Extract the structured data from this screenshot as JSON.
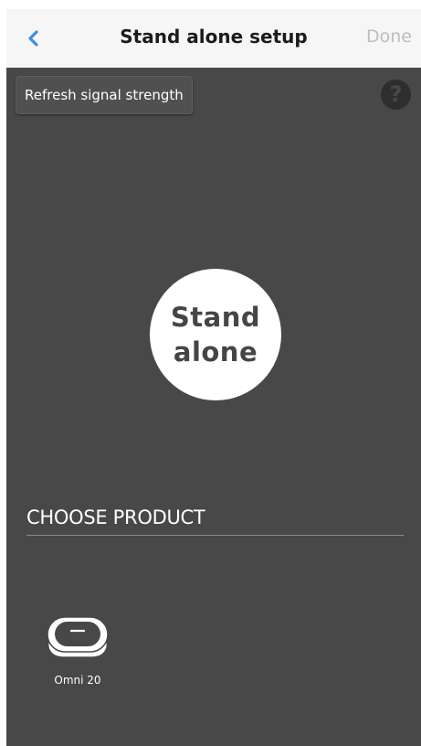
{
  "navbar": {
    "back_icon": "chevron-left-icon",
    "title": "Stand alone setup",
    "done_label": "Done",
    "accent_color": "#3b8ee6"
  },
  "toolbar": {
    "refresh_label": "Refresh signal strength",
    "help_icon": "question-mark-icon",
    "help_glyph": "?"
  },
  "mode": {
    "line1": "Stand",
    "line2": "alone"
  },
  "products_section": {
    "header": "CHOOSE PRODUCT",
    "items": [
      {
        "label": "Omni 20",
        "icon": "omni-20-device-icon"
      }
    ]
  }
}
